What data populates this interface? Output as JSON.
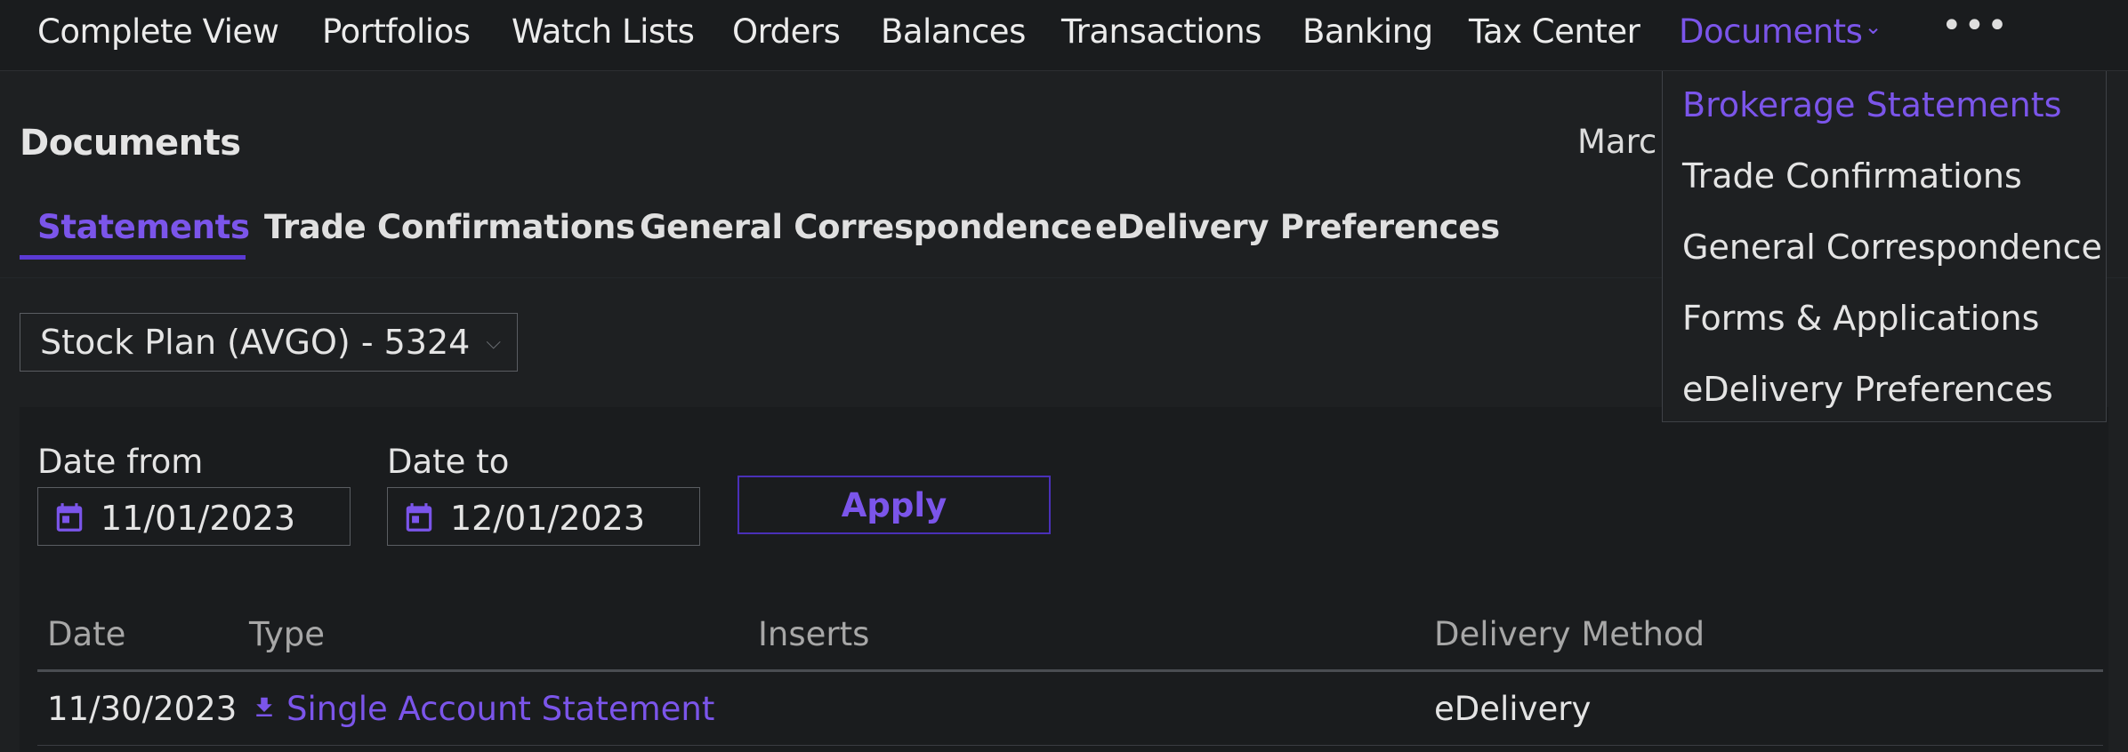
{
  "nav": {
    "items": [
      "Complete View",
      "Portfolios",
      "Watch Lists",
      "Orders",
      "Balances",
      "Transactions",
      "Banking",
      "Tax Center"
    ],
    "documents_label": "Documents",
    "more_label": "•••"
  },
  "page": {
    "title": "Documents",
    "truncated_text": "Marc"
  },
  "tabs": [
    "Statements",
    "Trade Confirmations",
    "General Correspondence",
    "eDelivery Preferences"
  ],
  "account_select": {
    "value": "Stock Plan (AVGO) - 5324"
  },
  "filters": {
    "date_from_label": "Date from",
    "date_from_value": "11/01/2023",
    "date_to_label": "Date to",
    "date_to_value": "12/01/2023",
    "apply_label": "Apply"
  },
  "table": {
    "headers": [
      "Date",
      "Type",
      "Inserts",
      "Delivery Method"
    ],
    "rows": [
      {
        "date": "11/30/2023",
        "type": "Single Account Statement",
        "inserts": "",
        "delivery": "eDelivery"
      }
    ]
  },
  "documents_menu": [
    "Brokerage Statements",
    "Trade Confirmations",
    "General Correspondence",
    "Forms & Applications",
    "eDelivery Preferences"
  ],
  "colors": {
    "accent": "#7b55ea",
    "accent_dark": "#5b3ad4",
    "background": "#1e2022"
  }
}
